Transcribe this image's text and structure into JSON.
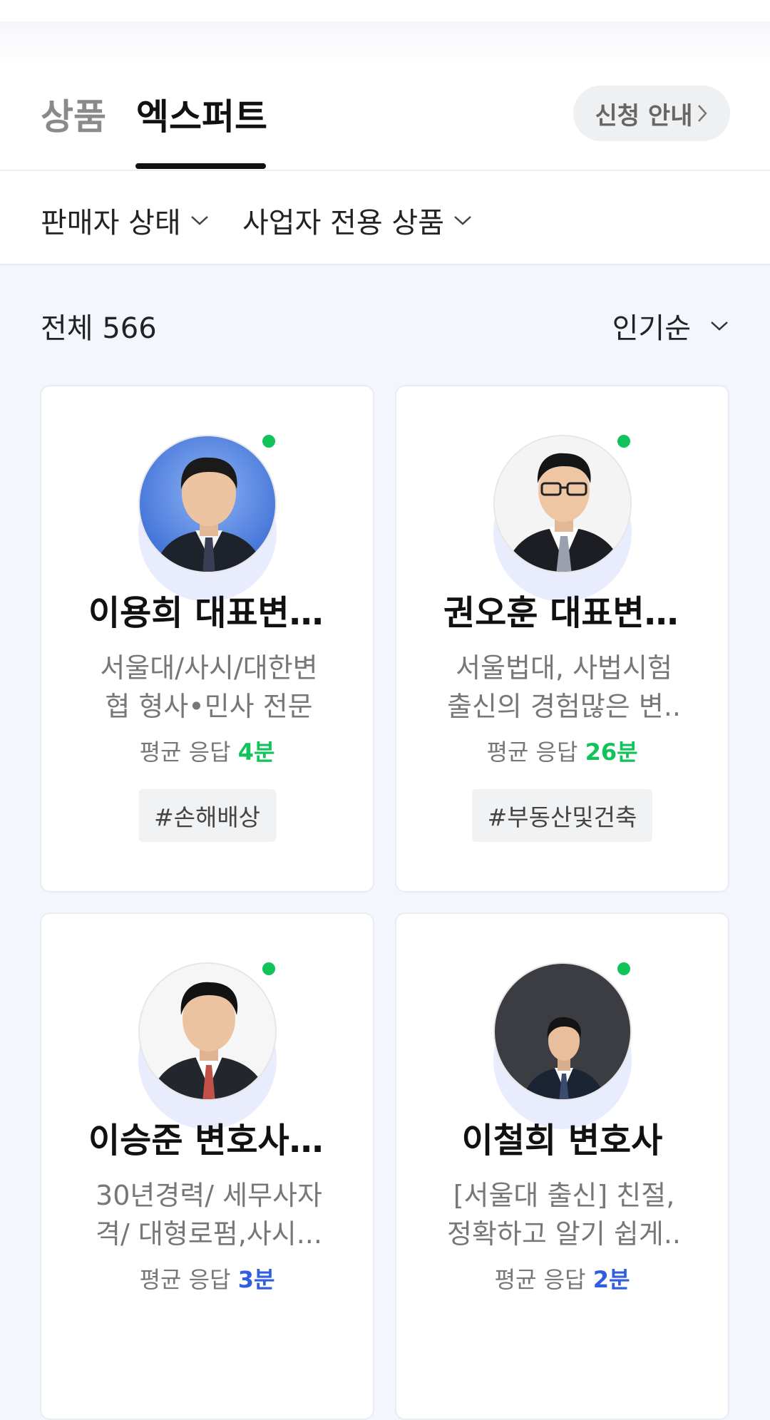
{
  "tabs": [
    {
      "label": "상품",
      "active": false
    },
    {
      "label": "엑스퍼트",
      "active": true
    }
  ],
  "apply_button": {
    "label": "신청 안내",
    "icon": "chevron-right-icon"
  },
  "filters": [
    {
      "label": "판매자 상태",
      "icon": "chevron-down-icon"
    },
    {
      "label": "사업자 전용 상품",
      "icon": "chevron-down-icon"
    }
  ],
  "list": {
    "count_label": "전체 566",
    "sort_label": "인기순"
  },
  "colors": {
    "online": "#10c45a",
    "response_green": "#10c45a",
    "response_blue": "#2f5fe0",
    "page_bg": "#f3f6fd"
  },
  "experts": [
    {
      "name": "이용희 대표변...",
      "description": "서울대/사시/대한변협 형사•민사 전문",
      "response_label": "평균 응답",
      "response_time": "4분",
      "tag": "#손해배상",
      "online": true
    },
    {
      "name": "권오훈 대표변...",
      "description": "서울법대, 사법시험 출신의 경험많은 변..",
      "response_label": "평균 응답",
      "response_time": "26분",
      "tag": "#부동산및건축",
      "online": true
    },
    {
      "name": "이승준 변호사...",
      "description": "30년경력/ 세무사자격/ 대형로펌,사시...",
      "response_label": "평균 응답",
      "response_time": "3분",
      "tag": "",
      "online": true
    },
    {
      "name": "이철희 변호사",
      "description": "[서울대 출신] 친절, 정확하고 알기 쉽게..",
      "response_label": "평균 응답",
      "response_time": "2분",
      "tag": "",
      "online": true
    }
  ]
}
